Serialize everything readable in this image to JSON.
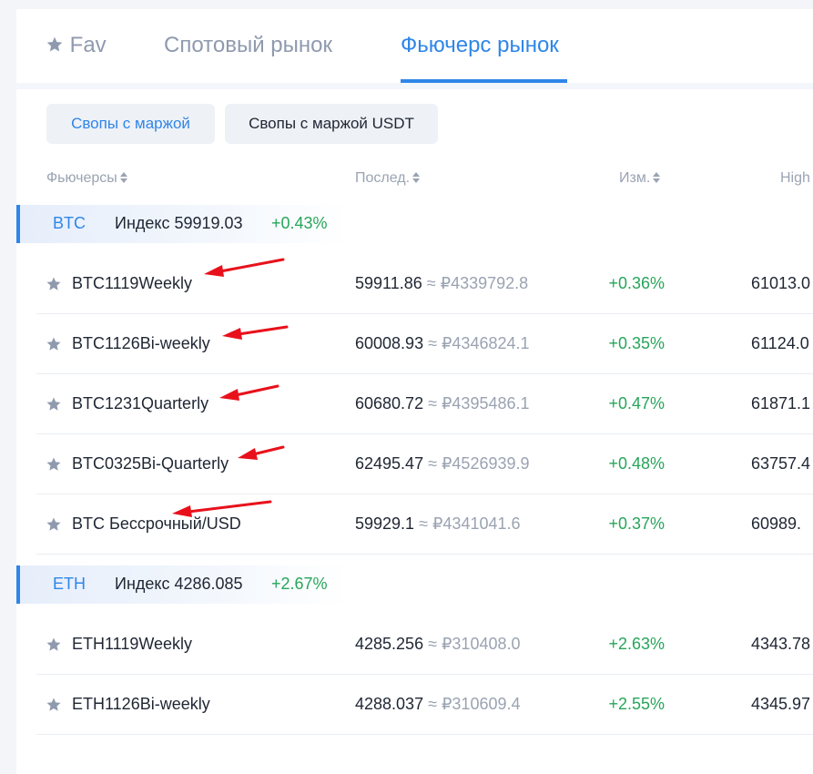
{
  "tabs": {
    "fav": "Fav",
    "spot": "Спотовый рынок",
    "futures": "Фьючерс рынок"
  },
  "subtabs": {
    "coin_margined": "Свопы с маржой",
    "usdt_margined": "Свопы с маржой USDT"
  },
  "columns": {
    "futures": "Фьючерсы",
    "last": "Послед.",
    "change": "Изм.",
    "high": "High"
  },
  "groups": [
    {
      "symbol": "BTC",
      "index": "Индекс 59919.03",
      "change": "+0.43%",
      "rows": [
        {
          "name": "BTC1119Weekly",
          "last": "59911.86",
          "approx": "≈ ₽4339792.8",
          "change": "+0.36%",
          "high": "61013.0"
        },
        {
          "name": "BTC1126Bi-weekly",
          "last": "60008.93",
          "approx": "≈ ₽4346824.1",
          "change": "+0.35%",
          "high": "61124.0"
        },
        {
          "name": "BTC1231Quarterly",
          "last": "60680.72",
          "approx": "≈ ₽4395486.1",
          "change": "+0.47%",
          "high": "61871.1"
        },
        {
          "name": "BTC0325Bi-Quarterly",
          "last": "62495.47",
          "approx": "≈ ₽4526939.9",
          "change": "+0.48%",
          "high": "63757.4"
        },
        {
          "name": "BTC Бессрочный/USD",
          "last": "59929.1",
          "approx": "≈ ₽4341041.6",
          "change": "+0.37%",
          "high": "60989."
        }
      ]
    },
    {
      "symbol": "ETH",
      "index": "Индекс 4286.085",
      "change": "+2.67%",
      "rows": [
        {
          "name": "ETH1119Weekly",
          "last": "4285.256",
          "approx": "≈ ₽310408.0",
          "change": "+2.63%",
          "high": "4343.78"
        },
        {
          "name": "ETH1126Bi-weekly",
          "last": "4288.037",
          "approx": "≈ ₽310609.4",
          "change": "+2.55%",
          "high": "4345.97"
        }
      ]
    }
  ],
  "colors": {
    "accent": "#2f86e8",
    "positive": "#27a55a",
    "muted": "#9aa3b2",
    "arrow": "#e8111b"
  }
}
